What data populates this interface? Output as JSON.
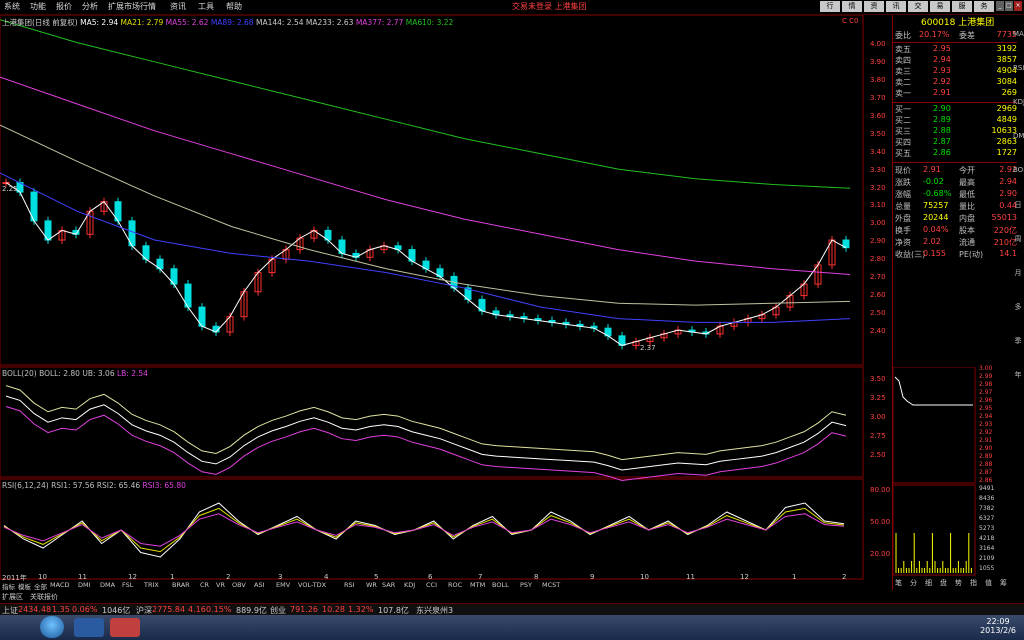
{
  "menu": [
    "系统",
    "功能",
    "报价",
    "分析",
    "扩展市场行情",
    "资讯",
    "工具",
    "帮助"
  ],
  "center_title": "交易未登录   上港集团",
  "tool_tabs": [
    "行",
    "情",
    "资",
    "讯",
    "交",
    "易",
    "服",
    "务"
  ],
  "stock": {
    "code": "600018",
    "name": "上港集团"
  },
  "legend_main": {
    "title": "上港集团(日线 前复权)",
    "ma5": "MA5: 2.94",
    "ma21": "MA21: 2.79",
    "ma55": "MA55: 2.62",
    "ma89": "MA89: 2.68",
    "ma144": "MA144: 2.54",
    "ma233": "MA233: 2.63",
    "ma377": "MA377: 2.77",
    "ma610": "MA610: 3.22"
  },
  "legend_boll": {
    "title": "BOLL(20)",
    "boll": "BOLL: 2.80",
    "ub": "UB: 3.06",
    "lb": "LB: 2.54"
  },
  "legend_rsi": {
    "title": "RSI(6,12,24)",
    "rsi1": "RSI1: 57.56",
    "rsi2": "RSI2: 65.46",
    "rsi3": "RSI3: 65.80"
  },
  "main_axis": [
    "4.00",
    "3.90",
    "3.80",
    "3.70",
    "3.60",
    "3.50",
    "3.40",
    "3.30",
    "3.20",
    "3.10",
    "3.00",
    "2.90",
    "2.80",
    "2.70",
    "2.60",
    "2.50",
    "2.40"
  ],
  "boll_axis": [
    "3.50",
    "3.25",
    "3.00",
    "2.75",
    "2.50"
  ],
  "rsi_axis": [
    "80.00",
    "50.00",
    "20.00"
  ],
  "annot": {
    "high": "2.37",
    "left": "2.25",
    "top_marker": "C C0"
  },
  "quote": {
    "weibi_label": "委比",
    "weibi": "20.17%",
    "weicha_label": "委差",
    "weicha": "7735",
    "sell": [
      {
        "l": "卖五",
        "p": "2.95",
        "v": "3192"
      },
      {
        "l": "卖四",
        "p": "2.94",
        "v": "3857"
      },
      {
        "l": "卖三",
        "p": "2.93",
        "v": "4904"
      },
      {
        "l": "卖二",
        "p": "2.92",
        "v": "3084"
      },
      {
        "l": "卖一",
        "p": "2.91",
        "v": "269"
      }
    ],
    "buy": [
      {
        "l": "买一",
        "p": "2.90",
        "v": "2969"
      },
      {
        "l": "买二",
        "p": "2.89",
        "v": "4849"
      },
      {
        "l": "买三",
        "p": "2.88",
        "v": "10633"
      },
      {
        "l": "买四",
        "p": "2.87",
        "v": "2863"
      },
      {
        "l": "买五",
        "p": "2.86",
        "v": "1727"
      }
    ],
    "stats": [
      {
        "l1": "现价",
        "v1": "2.91",
        "l2": "今开",
        "v2": "2.92"
      },
      {
        "l1": "涨跌",
        "v1": "-0.02",
        "l2": "最高",
        "v2": "2.94"
      },
      {
        "l1": "涨幅",
        "v1": "-0.68%",
        "l2": "最低",
        "v2": "2.90"
      },
      {
        "l1": "总量",
        "v1": "75257",
        "l2": "量比",
        "v2": "0.44"
      },
      {
        "l1": "外盘",
        "v1": "20244",
        "l2": "内盘",
        "v2": "55013"
      },
      {
        "l1": "换手",
        "v1": "0.04%",
        "l2": "股本",
        "v2": "220亿"
      },
      {
        "l1": "净资",
        "v1": "2.02",
        "l2": "流通",
        "v2": "210亿"
      },
      {
        "l1": "收益(三)",
        "v1": "0.155",
        "l2": "PE(动)",
        "v2": "14.1"
      }
    ]
  },
  "tick_price_axis": [
    "3.00",
    "2.99",
    "2.98",
    "2.97",
    "2.96",
    "2.95",
    "2.94",
    "2.93",
    "2.92",
    "2.91",
    "2.90",
    "2.89",
    "2.88",
    "2.87",
    "2.86"
  ],
  "tick_vol_axis": [
    "9491",
    "8436",
    "7382",
    "6327",
    "5273",
    "4218",
    "3164",
    "2109",
    "1055"
  ],
  "tick_tabs": [
    "笔",
    "分",
    "细",
    "盘",
    "势",
    "指",
    "值",
    "筹"
  ],
  "side_icons": [
    "MACD",
    "RSI",
    "KDJ",
    "DMI",
    "BOLL",
    "日",
    "周",
    "月",
    "多",
    "季",
    "年"
  ],
  "x_labels": [
    "2011年",
    "10",
    "11",
    "12",
    "1",
    "2",
    "3",
    "4",
    "5",
    "6",
    "7",
    "8",
    "9",
    "10",
    "11",
    "12",
    "1",
    "2"
  ],
  "indicator_tabs": [
    "指标",
    "模板",
    "全部",
    "MACD",
    "DMI",
    "DMA",
    "FSL",
    "TRIX",
    "BRAR",
    "CR",
    "VR",
    "OBV",
    "ASI",
    "EMV",
    "VOL-TDX",
    "RSI",
    "WR",
    "SAR",
    "KDJ",
    "CCI",
    "ROC",
    "MTM",
    "BOLL",
    "PSY",
    "MCST"
  ],
  "subtabs": [
    "扩展区",
    "关联报价"
  ],
  "status": {
    "sh_label": "上证",
    "sh": "2434.48",
    "sh_chg": "1.35",
    "sh_pct": "0.06%",
    "sh_amt": "1046亿",
    "sz_label": "沪深",
    "sz": "2775.84",
    "sz_chg": "4.16",
    "sz_pct": "0.15%",
    "sz_amt": "889.9亿",
    "cy_label": "创业",
    "cy": "791.26",
    "cy_chg": "10.28",
    "cy_pct": "1.32%",
    "cy_amt": "107.8亿",
    "broker": "东兴泉州3"
  },
  "clock": {
    "time": "22:09",
    "date": "2013/2/6"
  },
  "chart_data": {
    "type": "line",
    "title": "上港集团(日线 前复权)",
    "ylim": [
      2.35,
      4.02
    ],
    "close": [
      3.25,
      3.2,
      3.05,
      2.95,
      3.0,
      2.98,
      3.1,
      3.15,
      3.05,
      2.92,
      2.85,
      2.8,
      2.72,
      2.6,
      2.5,
      2.47,
      2.55,
      2.68,
      2.78,
      2.85,
      2.9,
      2.96,
      3.0,
      2.95,
      2.88,
      2.86,
      2.9,
      2.92,
      2.9,
      2.84,
      2.8,
      2.76,
      2.7,
      2.64,
      2.58,
      2.56,
      2.55,
      2.54,
      2.53,
      2.52,
      2.51,
      2.5,
      2.49,
      2.45,
      2.4,
      2.42,
      2.44,
      2.46,
      2.48,
      2.47,
      2.46,
      2.5,
      2.52,
      2.54,
      2.56,
      2.6,
      2.66,
      2.72,
      2.82,
      2.95,
      2.91
    ],
    "ma_series": [
      {
        "name": "MA610",
        "color": "#20c020",
        "values": [
          4.1,
          3.98,
          3.88,
          3.78,
          3.68,
          3.58,
          3.48,
          3.4,
          3.32,
          3.27,
          3.24,
          3.22
        ]
      },
      {
        "name": "MA377",
        "color": "#e040e0",
        "values": [
          3.8,
          3.66,
          3.52,
          3.4,
          3.28,
          3.16,
          3.06,
          2.98,
          2.9,
          2.84,
          2.8,
          2.77
        ]
      },
      {
        "name": "MA233",
        "color": "#c0c0a0",
        "values": [
          3.55,
          3.36,
          3.18,
          3.02,
          2.9,
          2.8,
          2.72,
          2.66,
          2.62,
          2.61,
          2.62,
          2.63
        ]
      },
      {
        "name": "MA144",
        "color": "#4040ff",
        "values": [
          3.3,
          3.1,
          2.95,
          2.88,
          2.84,
          2.78,
          2.7,
          2.6,
          2.54,
          2.52,
          2.52,
          2.54
        ]
      }
    ],
    "rsi1": [
      55,
      40,
      30,
      45,
      60,
      35,
      50,
      25,
      20,
      40,
      70,
      80,
      60,
      45,
      55,
      65,
      50,
      40,
      60,
      55,
      45,
      50,
      60,
      40,
      55,
      65,
      45,
      50,
      70,
      60,
      45,
      55,
      65,
      50,
      60,
      45,
      55,
      70,
      60,
      50,
      75,
      80,
      60,
      57
    ]
  }
}
